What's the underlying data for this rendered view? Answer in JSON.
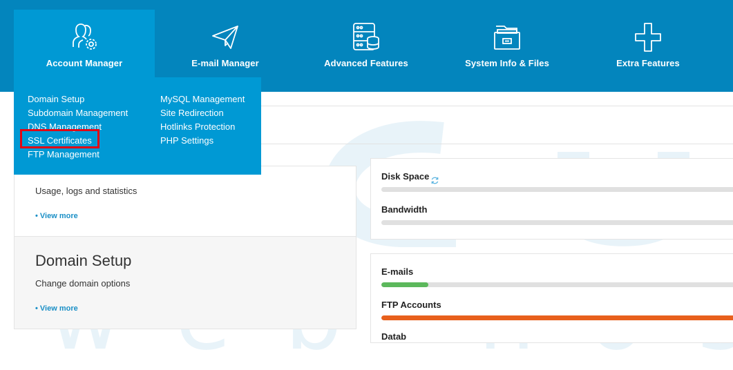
{
  "nav": {
    "items": [
      {
        "label": "Account Manager",
        "icon": "users-gear-icon",
        "active": true
      },
      {
        "label": "E-mail Manager",
        "icon": "paper-plane-icon"
      },
      {
        "label": "Advanced Features",
        "icon": "database-icon"
      },
      {
        "label": "System Info & Files",
        "icon": "folder-icon"
      },
      {
        "label": "Extra Features",
        "icon": "plus-icon"
      }
    ]
  },
  "dropdown": {
    "col1": [
      "Domain Setup",
      "Subdomain Management",
      "DNS Management",
      "SSL Certificates",
      "FTP Management"
    ],
    "col2": [
      "MySQL Management",
      "Site Redirection",
      "Hotlinks Protection",
      "PHP Settings"
    ],
    "highlighted": "SSL Certificates",
    "highlight_color": "#e30613"
  },
  "cards": {
    "stats": {
      "desc": "Usage, logs and statistics",
      "more": "• View more"
    },
    "domain_setup": {
      "title": "Domain Setup",
      "desc": "Change domain options",
      "more": "• View more"
    }
  },
  "usage": {
    "disk_space": {
      "label": "Disk Space",
      "fraction": 0.0
    },
    "bandwidth": {
      "label": "Bandwidth",
      "fraction": 0.0
    },
    "emails": {
      "label": "E-mails",
      "fraction": 0.13,
      "color": "#5cb85c"
    },
    "ftp_accounts": {
      "label": "FTP Accounts",
      "fraction": 1.0,
      "color": "#e8601c"
    },
    "databases": {
      "label": "Datab"
    }
  },
  "watermark": {
    "text": "web hosting"
  },
  "colors": {
    "nav_bg": "#0385bd",
    "active_bg": "#0099d4",
    "link": "#1a8fc6"
  }
}
